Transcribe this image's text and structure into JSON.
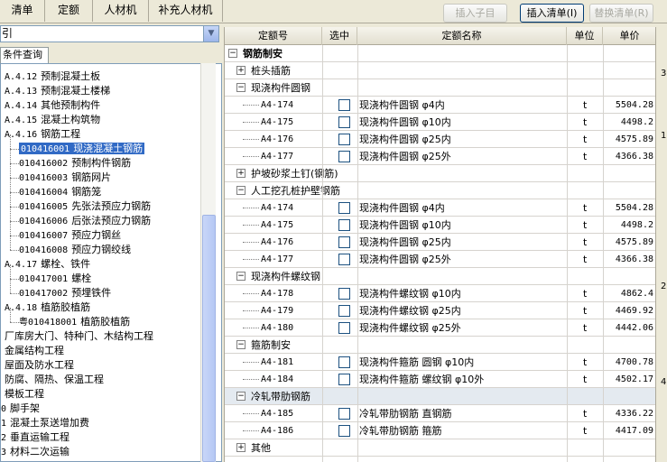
{
  "tabs": [
    "清单",
    "定额",
    "人材机",
    "补充人材机"
  ],
  "buttons": {
    "insert_child": "插入子目",
    "insert_list": "插入清单(I)",
    "replace_list": "替换清单(R)"
  },
  "combo_value": "引",
  "query_tab": "条件查询",
  "tree": [
    {
      "code": "A.4.12",
      "name": "预制混凝土板"
    },
    {
      "code": "A.4.13",
      "name": "预制混凝土楼梯"
    },
    {
      "code": "A.4.14",
      "name": "其他预制构件"
    },
    {
      "code": "A.4.15",
      "name": "混凝土构筑物"
    },
    {
      "code": "A.4.16",
      "name": "钢筋工程"
    },
    {
      "code": "010416001",
      "name": "现浇混凝土钢筋",
      "selected": true
    },
    {
      "code": "010416002",
      "name": "预制构件钢筋"
    },
    {
      "code": "010416003",
      "name": "钢筋网片"
    },
    {
      "code": "010416004",
      "name": "钢筋笼"
    },
    {
      "code": "010416005",
      "name": "先张法预应力钢筋"
    },
    {
      "code": "010416006",
      "name": "后张法预应力钢筋"
    },
    {
      "code": "010416007",
      "name": "预应力钢丝"
    },
    {
      "code": "010416008",
      "name": "预应力钢绞线"
    },
    {
      "code": "A.4.17",
      "name": "螺栓、铁件"
    },
    {
      "code": "010417001",
      "name": "螺栓"
    },
    {
      "code": "010417002",
      "name": "预埋铁件"
    },
    {
      "code": "A.4.18",
      "name": "植筋胶植筋"
    },
    {
      "code": "粤010418001",
      "name": "植筋胶植筋"
    },
    {
      "code": "",
      "name": "厂库房大门、特种门、木结构工程"
    },
    {
      "code": "",
      "name": "金属结构工程"
    },
    {
      "code": "",
      "name": "屋面及防水工程"
    },
    {
      "code": "",
      "name": "防腐、隔热、保温工程"
    },
    {
      "code": "",
      "name": "模板工程"
    },
    {
      "code": "0",
      "name": "脚手架"
    },
    {
      "code": "1",
      "name": "混凝土泵送增加费"
    },
    {
      "code": "2",
      "name": "垂直运输工程"
    },
    {
      "code": "3",
      "name": "材料二次运输"
    }
  ],
  "grid": {
    "headers": [
      "定额号",
      "选中",
      "定额名称",
      "单位",
      "单价"
    ],
    "rows": [
      {
        "type": "group0",
        "name": "钢筋制安",
        "sign": "−"
      },
      {
        "type": "group",
        "name": "桩头插筋",
        "sign": "+"
      },
      {
        "type": "group",
        "name": "现浇构件圆钢",
        "sign": "−"
      },
      {
        "type": "item",
        "code": "A4-174",
        "name": "现浇构件圆钢 φ4内",
        "unit": "t",
        "price": "5504.28"
      },
      {
        "type": "item",
        "code": "A4-175",
        "name": "现浇构件圆钢 φ10内",
        "unit": "t",
        "price": "4498.2"
      },
      {
        "type": "item",
        "code": "A4-176",
        "name": "现浇构件圆钢 φ25内",
        "unit": "t",
        "price": "4575.89"
      },
      {
        "type": "item",
        "code": "A4-177",
        "name": "现浇构件圆钢 φ25外",
        "unit": "t",
        "price": "4366.38"
      },
      {
        "type": "group",
        "name": "护坡砂浆土钉(钢筋)",
        "sign": "+"
      },
      {
        "type": "group",
        "name": "人工挖孔桩护壁钢筋",
        "sign": "−"
      },
      {
        "type": "item",
        "code": "A4-174",
        "name": "现浇构件圆钢 φ4内",
        "unit": "t",
        "price": "5504.28"
      },
      {
        "type": "item",
        "code": "A4-175",
        "name": "现浇构件圆钢 φ10内",
        "unit": "t",
        "price": "4498.2"
      },
      {
        "type": "item",
        "code": "A4-176",
        "name": "现浇构件圆钢 φ25内",
        "unit": "t",
        "price": "4575.89"
      },
      {
        "type": "item",
        "code": "A4-177",
        "name": "现浇构件圆钢 φ25外",
        "unit": "t",
        "price": "4366.38"
      },
      {
        "type": "group",
        "name": "现浇构件螺纹钢",
        "sign": "−"
      },
      {
        "type": "item",
        "code": "A4-178",
        "name": "现浇构件螺纹钢 φ10内",
        "unit": "t",
        "price": "4862.4"
      },
      {
        "type": "item",
        "code": "A4-179",
        "name": "现浇构件螺纹钢 φ25内",
        "unit": "t",
        "price": "4469.92"
      },
      {
        "type": "item",
        "code": "A4-180",
        "name": "现浇构件螺纹钢 φ25外",
        "unit": "t",
        "price": "4442.06"
      },
      {
        "type": "group",
        "name": "箍筋制安",
        "sign": "−"
      },
      {
        "type": "item",
        "code": "A4-181",
        "name": "现浇构件箍筋 圆钢 φ10内",
        "unit": "t",
        "price": "4700.78"
      },
      {
        "type": "item",
        "code": "A4-184",
        "name": "现浇构件箍筋 螺纹钢 φ10外",
        "unit": "t",
        "price": "4502.17"
      },
      {
        "type": "group",
        "name": "冷轧带肋钢筋",
        "sign": "−",
        "highlight": true
      },
      {
        "type": "item",
        "code": "A4-185",
        "name": "冷轧带肋钢筋 直钢筋",
        "unit": "t",
        "price": "4336.22"
      },
      {
        "type": "item",
        "code": "A4-186",
        "name": "冷轧带肋钢筋 箍筋",
        "unit": "t",
        "price": "4417.09"
      },
      {
        "type": "group",
        "name": "其他",
        "sign": "+"
      }
    ]
  },
  "right_strip": [
    "3",
    "1",
    "2",
    "4"
  ]
}
